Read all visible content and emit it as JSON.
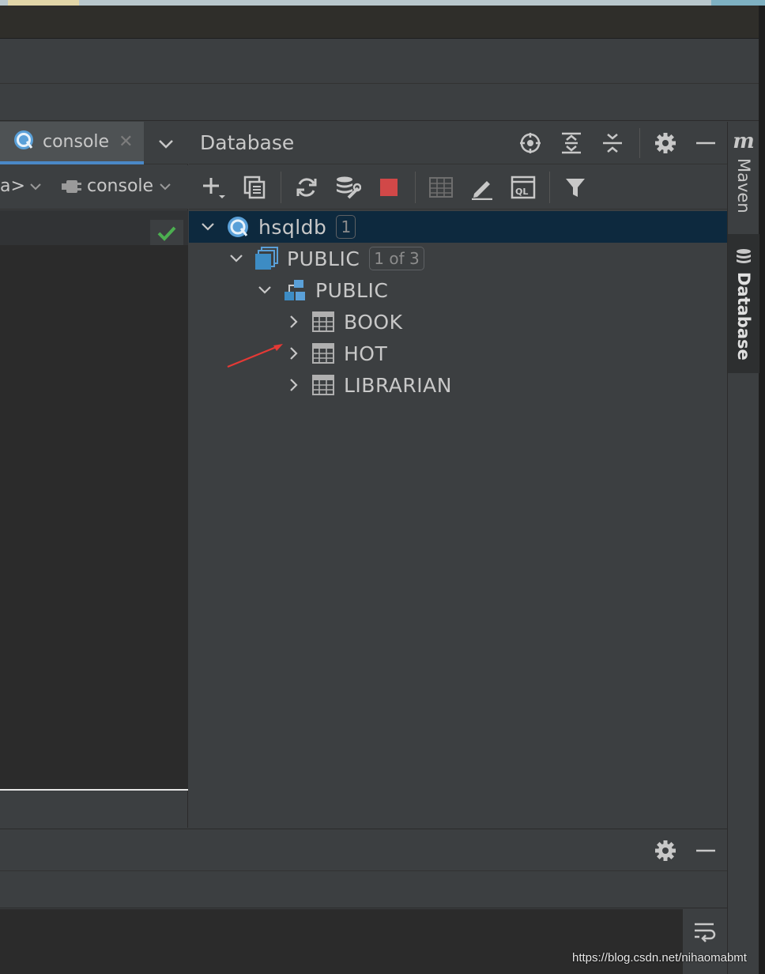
{
  "editor": {
    "tab_label": "console",
    "schema_label": "a>",
    "session_label": "console"
  },
  "database_panel": {
    "title": "Database",
    "header_icons": [
      "locate-icon",
      "expand-all-icon",
      "collapse-all-icon",
      "gear-icon",
      "minimize-icon"
    ],
    "toolbar_icons": [
      "add-icon",
      "duplicate-icon",
      "refresh-icon",
      "schema-settings-icon",
      "stop-icon",
      "table-view-icon",
      "edit-icon",
      "ql-console-icon",
      "filter-icon"
    ],
    "tree": [
      {
        "label": "hsqldb",
        "badge": "1",
        "icon": "datasource-icon",
        "expanded": true,
        "selected": true,
        "level": 0
      },
      {
        "label": "PUBLIC",
        "badge": "1 of 3",
        "icon": "database-icon",
        "expanded": true,
        "level": 1
      },
      {
        "label": "PUBLIC",
        "icon": "schema-icon",
        "expanded": true,
        "level": 2
      },
      {
        "label": "BOOK",
        "icon": "table-icon",
        "expanded": false,
        "level": 3
      },
      {
        "label": "HOT",
        "icon": "table-icon",
        "expanded": false,
        "level": 3
      },
      {
        "label": "LIBRARIAN",
        "icon": "table-icon",
        "expanded": false,
        "level": 3
      }
    ]
  },
  "side_tabs": {
    "maven_logo": "m",
    "maven": "Maven",
    "database": "Database"
  },
  "watermark": "https://blog.csdn.net/nihaomabmt",
  "colors": {
    "background": "#3c3f41",
    "editor_background": "#2b2b2b",
    "selection": "#0d293e",
    "accent": "#4a88c7",
    "stop_red": "#d14848",
    "ok_green": "#4caf50",
    "arrow_red": "#e53935"
  }
}
